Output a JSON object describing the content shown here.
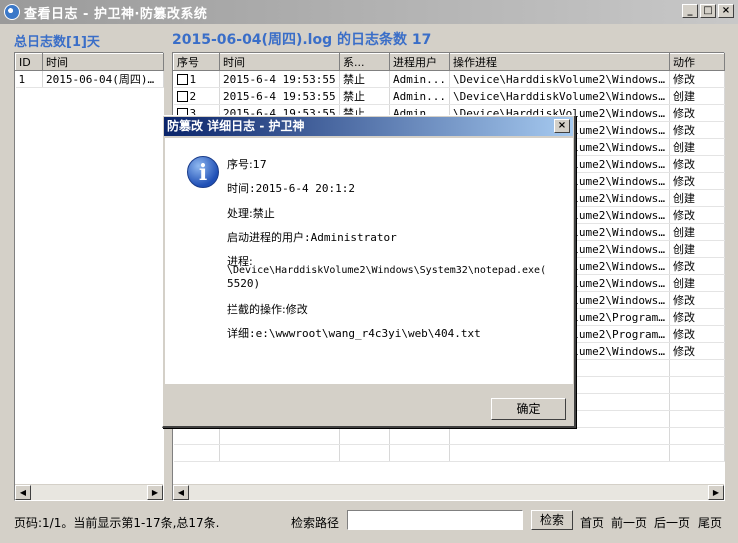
{
  "window": {
    "title": "查看日志 - 护卫神·防篡改系统",
    "minimize": "_",
    "maximize": "□",
    "close": "×"
  },
  "left": {
    "header": "总日志数[1]天",
    "columns": [
      "ID",
      "时间"
    ],
    "rows": [
      [
        "1",
        "2015-06-04(周四)..."
      ]
    ]
  },
  "right": {
    "header": "2015-06-04(周四).log 的日志条数 17",
    "columns": [
      "序号",
      "时间",
      "系...",
      "进程用户",
      "操作进程",
      "动作"
    ],
    "rows": [
      [
        "1",
        "2015-6-4 19:53:55",
        "禁止",
        "Admin...",
        "\\Device\\HarddiskVolume2\\Windows...",
        "修改"
      ],
      [
        "2",
        "2015-6-4 19:53:55",
        "禁止",
        "Admin...",
        "\\Device\\HarddiskVolume2\\Windows...",
        "创建"
      ],
      [
        "3",
        "2015-6-4 19:53:55",
        "禁止",
        "Admin...",
        "\\Device\\HarddiskVolume2\\Windows...",
        "修改"
      ],
      [
        "",
        "",
        "",
        "",
        "\\Device\\HarddiskVolume2\\Windows...",
        "修改"
      ],
      [
        "",
        "",
        "",
        "",
        "\\Device\\HarddiskVolume2\\Windows...",
        "创建"
      ],
      [
        "",
        "",
        "",
        "",
        "\\Device\\HarddiskVolume2\\Windows...",
        "修改"
      ],
      [
        "",
        "",
        "",
        "",
        "\\Device\\HarddiskVolume2\\Windows...",
        "修改"
      ],
      [
        "",
        "",
        "",
        "",
        "\\Device\\HarddiskVolume2\\Windows...",
        "创建"
      ],
      [
        "",
        "",
        "",
        "",
        "\\Device\\HarddiskVolume2\\Windows...",
        "修改"
      ],
      [
        "",
        "",
        "",
        "",
        "\\Device\\HarddiskVolume2\\Windows...",
        "创建"
      ],
      [
        "",
        "",
        "",
        "",
        "\\Device\\HarddiskVolume2\\Windows...",
        "创建"
      ],
      [
        "",
        "",
        "",
        "",
        "\\Device\\HarddiskVolume2\\Windows...",
        "修改"
      ],
      [
        "",
        "",
        "",
        "",
        "\\Device\\HarddiskVolume2\\Windows...",
        "创建"
      ],
      [
        "",
        "",
        "",
        "",
        "\\Device\\HarddiskVolume2\\Windows...",
        "修改"
      ],
      [
        "",
        "",
        "",
        "",
        "\\Device\\HarddiskVolume2\\Program...",
        "修改"
      ],
      [
        "",
        "",
        "",
        "",
        "\\Device\\HarddiskVolume2\\Program...",
        "修改"
      ],
      [
        "",
        "",
        "",
        "",
        "\\Device\\HarddiskVolume2\\Windows...",
        "修改"
      ]
    ]
  },
  "footer": {
    "status": "页码:1/1。当前显示第1-17条,总17条.",
    "search_label": "检索路径",
    "search_value": "",
    "search_button": "检索",
    "first": "首页",
    "prev": "前一页",
    "next": "后一页",
    "last": "尾页"
  },
  "dialog": {
    "title": "防篡改 详细日志 - 护卫神",
    "close": "×",
    "serial": "序号:17",
    "time": "时间:2015-6-4 20:1:2",
    "handling": "处理:禁止",
    "user": "启动进程的用户:Administrator",
    "process_label": "进程:",
    "process_path": "\\Device\\HarddiskVolume2\\Windows\\System32\\notepad.exe(",
    "process_pid": "5520)",
    "operation": "拦截的操作:修改",
    "detail": "详细:e:\\wwwroot\\wang_r4c3yi\\web\\404.txt",
    "ok": "确定"
  }
}
